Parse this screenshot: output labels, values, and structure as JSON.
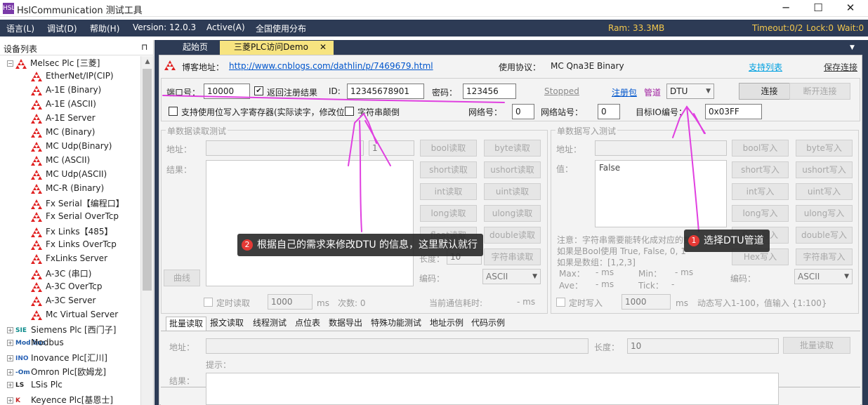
{
  "window": {
    "title": "HslCommunication 测试工具",
    "app_icon": "HSL",
    "min": "─",
    "max": "☐",
    "close": "✕"
  },
  "menu": {
    "items": [
      "语言(L)",
      "调试(D)",
      "帮助(H)",
      "Version: 12.0.3",
      "Active(A)",
      "全国使用分布"
    ],
    "ram": "Ram: 33.3MB",
    "timeout": "Timeout:0/2",
    "lock": "Lock:0",
    "wait": "Wait:0"
  },
  "left_panel": {
    "title": "设备列表",
    "pin_icon": "pin-icon",
    "tree": [
      {
        "label": "Melsec Plc [三菱]",
        "level": 0,
        "expander": "−",
        "icon": "mitsubishi-icon"
      },
      {
        "label": "EtherNet/IP(CIP)",
        "level": 1,
        "icon": "mitsubishi-icon"
      },
      {
        "label": "A-1E (Binary)",
        "level": 1,
        "icon": "mitsubishi-icon"
      },
      {
        "label": "A-1E (ASCII)",
        "level": 1,
        "icon": "mitsubishi-icon"
      },
      {
        "label": "A-1E Server",
        "level": 1,
        "icon": "mitsubishi-icon"
      },
      {
        "label": "MC (Binary)",
        "level": 1,
        "icon": "mitsubishi-icon"
      },
      {
        "label": "MC Udp(Binary)",
        "level": 1,
        "icon": "mitsubishi-icon"
      },
      {
        "label": "MC (ASCII)",
        "level": 1,
        "icon": "mitsubishi-icon"
      },
      {
        "label": "MC Udp(ASCII)",
        "level": 1,
        "icon": "mitsubishi-icon"
      },
      {
        "label": "MC-R (Binary)",
        "level": 1,
        "icon": "mitsubishi-icon"
      },
      {
        "label": "Fx Serial【编程口】",
        "level": 1,
        "icon": "mitsubishi-icon"
      },
      {
        "label": "Fx Serial OverTcp",
        "level": 1,
        "icon": "mitsubishi-icon"
      },
      {
        "label": "Fx Links【485】",
        "level": 1,
        "icon": "mitsubishi-icon"
      },
      {
        "label": "Fx Links OverTcp",
        "level": 1,
        "icon": "mitsubishi-icon"
      },
      {
        "label": "FxLinks Server",
        "level": 1,
        "icon": "mitsubishi-icon"
      },
      {
        "label": "A-3C (串口)",
        "level": 1,
        "icon": "mitsubishi-icon"
      },
      {
        "label": "A-3C OverTcp",
        "level": 1,
        "icon": "mitsubishi-icon"
      },
      {
        "label": "A-3C Server",
        "level": 1,
        "icon": "mitsubishi-icon"
      },
      {
        "label": "Mc Virtual Server",
        "level": 1,
        "icon": "mitsubishi-icon"
      },
      {
        "label": "Siemens Plc [西门子]",
        "level": 0,
        "expander": "+",
        "brand": "SIE",
        "brand_color": "#0a8a8a"
      },
      {
        "label": "Modbus",
        "level": 0,
        "expander": "+",
        "brand": "Mod bus",
        "brand_color": "#1e5aa8"
      },
      {
        "label": "Inovance Plc[汇川]",
        "level": 0,
        "expander": "+",
        "brand": "INO",
        "brand_color": "#2a62b8"
      },
      {
        "label": "Omron Plc[欧姆龙]",
        "level": 0,
        "expander": "+",
        "brand": "-Om",
        "brand_color": "#1e5aa8"
      },
      {
        "label": "LSis Plc",
        "level": 0,
        "expander": "+",
        "brand": "LS",
        "brand_color": "#222222"
      },
      {
        "label": "Keyence Plc[基恩士]",
        "level": 0,
        "expander": "+",
        "brand": "K",
        "brand_color": "#c62828"
      }
    ]
  },
  "doc_tabs": {
    "start": "起始页",
    "demo": "三菱PLC访问Demo",
    "close": "✕",
    "dropdown": "▼"
  },
  "header": {
    "blog_label": "博客地址：",
    "blog_url": "http://www.cnblogs.com/dathlin/p/7469679.html",
    "protocol_label": "使用协议：",
    "protocol_value": "MC Qna3E Binary",
    "support_link": "支持列表",
    "save_link": "保存连接"
  },
  "connection": {
    "port_label": "端口号：",
    "port_value": "10000",
    "return_label": "返回注册结果",
    "return_checked": "✔",
    "id_label": "ID:",
    "id_value": "12345678901",
    "password_label": "密码：",
    "password_value": "123456",
    "status": "Stopped",
    "register_link": "注册包",
    "pipe_label": "管道",
    "pipe_value": "DTU",
    "connect_button": "连接",
    "disconnect_button": "断开连接",
    "bit_label": "支持使用位写入字寄存器(实际读字，修改位",
    "string_reverse_label": "字符串颠倒",
    "network_label": "网络号：",
    "network_value": "0",
    "station_label": "网络站号：",
    "station_value": "0",
    "target_io_label": "目标IO编号：",
    "target_io_value": "0x03FF"
  },
  "read_panel": {
    "title": "单数据读取测试",
    "address_label": "地址：",
    "length_value": "1",
    "result_label": "结果：",
    "buttons": [
      "bool读取",
      "byte读取",
      "short读取",
      "ushort读取",
      "int读取",
      "uint读取",
      "long读取",
      "ulong读取",
      "float读取",
      "double读取",
      "",
      "字符串读取"
    ],
    "length_label": "长度：",
    "length_value2": "10",
    "encoding_label": "编码：",
    "encoding_value": "ASCII",
    "curve_button": "曲线",
    "timed_read_label": "定时读取",
    "interval_value": "1000",
    "ms": "ms",
    "count_label": "次数: 0",
    "comm_time_label": "当前通信耗时:",
    "comm_time_value": "- ms"
  },
  "write_panel": {
    "title": "单数据写入测试",
    "address_label": "地址：",
    "value_label": "值：",
    "value_content": "False",
    "buttons": [
      "bool写入",
      "byte写入",
      "short写入",
      "ushort写入",
      "int写入",
      "uint写入",
      "long写入",
      "ulong写入",
      "float写入",
      "double写入",
      "Hex写入",
      "字符串写入"
    ],
    "note1": "注意：字符串需要能转化成对应的数",
    "note2": "如果是Bool使用 True, False, 0, 1",
    "note3": "如果是数组：[1,2,3]",
    "max_label": "Max：",
    "max_value": "- ms",
    "min_label": "Min：",
    "min_value": "- ms",
    "ave_label": "Ave：",
    "ave_value": "- ms",
    "tick_label": "Tick：",
    "tick_value": "-",
    "encoding_label": "编码：",
    "encoding_value": "ASCII",
    "timed_write_label": "定时写入",
    "interval_value": "1000",
    "ms": "ms",
    "dynamic_note": "动态写入1-100，值输入 {1:100}"
  },
  "bottom_tabs": [
    "批量读取",
    "报文读取",
    "线程测试",
    "点位表",
    "数据导出",
    "特殊功能测试",
    "地址示例",
    "代码示例"
  ],
  "batch": {
    "address_label": "地址：",
    "length_label": "长度：",
    "length_value": "10",
    "read_button": "批量读取",
    "hint_label": "提示：",
    "result_label": "结果："
  },
  "annotations": {
    "callout1_num": "1",
    "callout1_text": "选择DTU管道",
    "callout2_num": "2",
    "callout2_text": "根据自己的需求来修改DTU 的信息，这里默认就行",
    "stroke_color": "#e040e0"
  }
}
